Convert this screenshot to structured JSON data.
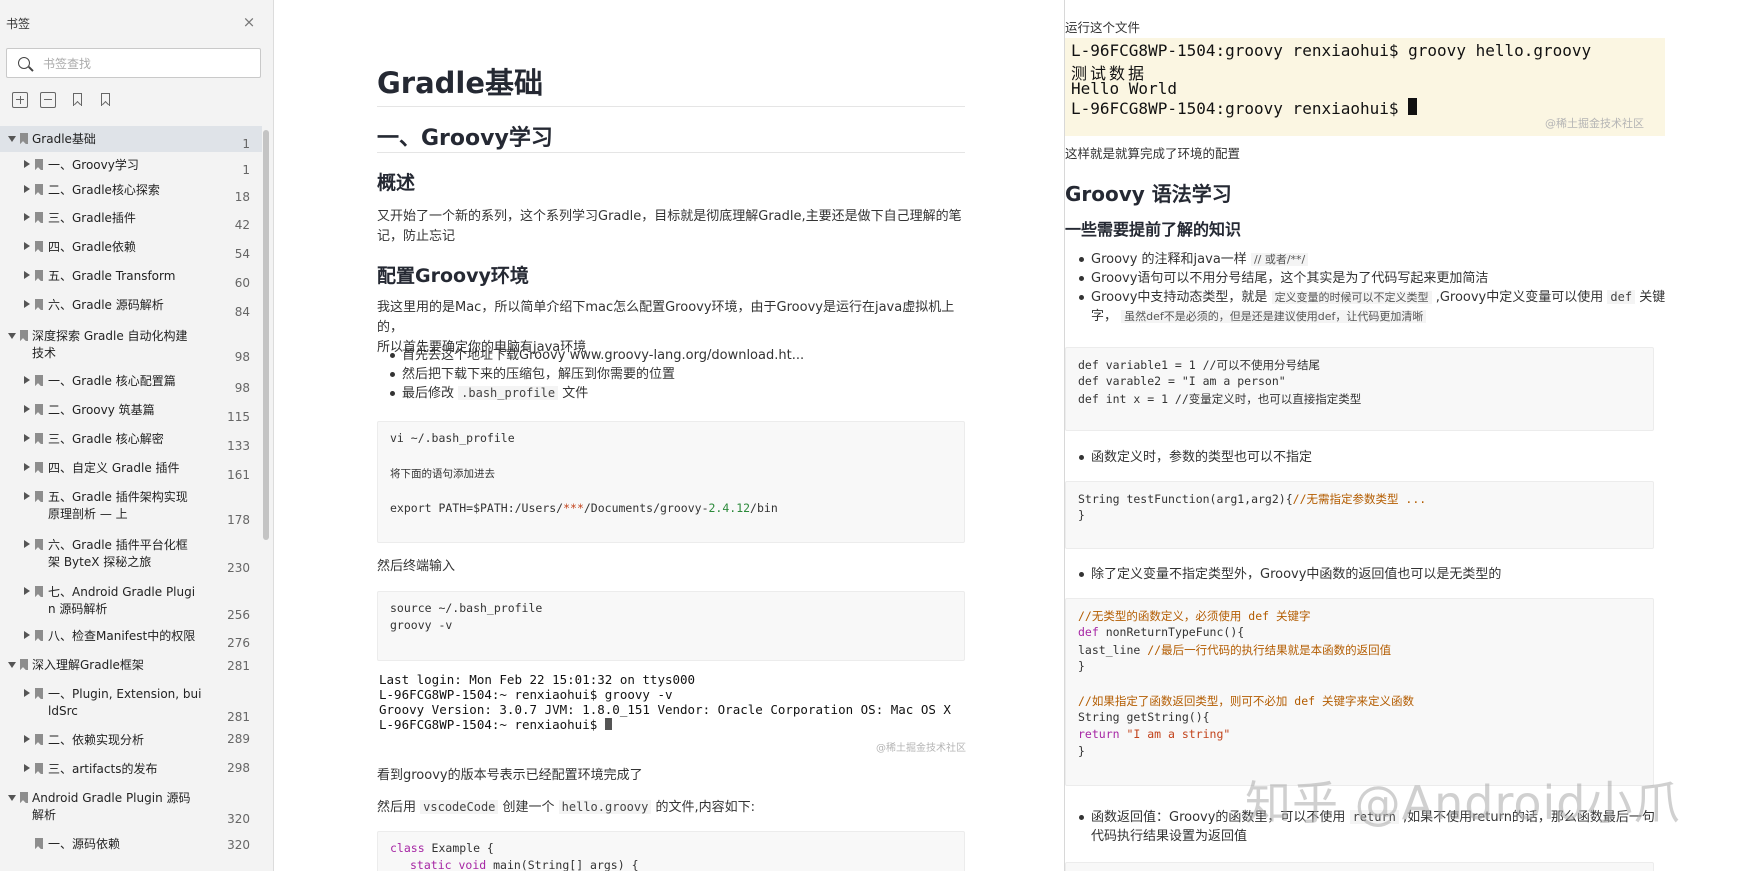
{
  "sidebar": {
    "title": "书签",
    "close_symbol": "×",
    "search_placeholder": "书签查找",
    "tools": [
      "expand-all-icon",
      "collapse-all-icon",
      "bookmark-icon",
      "bookmark-add-icon"
    ],
    "items": [
      {
        "label": "Gradle基础",
        "page": "1"
      },
      {
        "label": "一、Groovy学习",
        "page": "1"
      },
      {
        "label": "二、Gradle核心探索",
        "page": "18"
      },
      {
        "label": "三、Gradle插件",
        "page": "42"
      },
      {
        "label": "四、Gradle依赖",
        "page": "54"
      },
      {
        "label": "五、Gradle Transform",
        "page": "60"
      },
      {
        "label": "六、Gradle 源码解析",
        "page": "84"
      },
      {
        "label": "深度探索 Gradle 自动化构建",
        "label2": "技术",
        "page": "98"
      },
      {
        "label": "一、Gradle 核心配置篇",
        "page": "98"
      },
      {
        "label": "二、Groovy 筑基篇",
        "page": "115"
      },
      {
        "label": "三、Gradle 核心解密",
        "page": "133"
      },
      {
        "label": "四、自定义 Gradle 插件",
        "page": "161"
      },
      {
        "label": "五、Gradle 插件架构实现",
        "label2": "原理剖析 — 上",
        "page": "178"
      },
      {
        "label": "六、Gradle 插件平台化框",
        "label2": "架 ByteX 探秘之旅",
        "page": "230"
      },
      {
        "label": "七、Android Gradle Plugi",
        "label2": "n 源码解析",
        "page": "256"
      },
      {
        "label": "八、检查Manifest中的权限",
        "page": "276"
      },
      {
        "label": "深入理解Gradle框架",
        "page": "281"
      },
      {
        "label": "一、Plugin, Extension, bui",
        "label2": "ldSrc",
        "page": "281"
      },
      {
        "label": "二、依赖实现分析",
        "page": "289"
      },
      {
        "label": "三、artifacts的发布",
        "page": "298"
      },
      {
        "label": "Android Gradle Plugin 源码",
        "label2": "解析",
        "page": "320"
      },
      {
        "label": "一、源码依赖",
        "page": "320"
      }
    ]
  },
  "left_page": {
    "title": "Gradle基础",
    "h2": "一、Groovy学习",
    "h3_overview": "概述",
    "overview": "又开始了一个新的系列，这个系列学习Gradle，目标就是彻底理解Gradle,主要还是做下自己理解的笔",
    "overview2": "记，防止忘记",
    "h3_config": "配置Groovy环境",
    "config_p1": "我这里用的是Mac，所以简单介绍下mac怎么配置Groovy环境，由于Groovy是运行在java虚拟机上的，",
    "config_p2": "所以首先要确定你的电脑有java环境",
    "bullet1_pre": "首先去这个地址下载Groovy ",
    "bullet1_link": "www.groovy-lang.org/download.ht...",
    "bullet2": "然后把下载下来的压缩包，解压到你需要的位置",
    "bullet3_pre": "最后修改 ",
    "bullet3_code": ".bash_profile",
    "bullet3_post": " 文件",
    "code1_l1": "vi ~/.bash_profile",
    "code1_l2": "将下面的语句添加进去",
    "code1_l3a": "export PATH=$PATH:/Users/",
    "code1_l3b": "***",
    "code1_l3c": "/Documents/groovy-",
    "code1_l3d": "2.4.12",
    "code1_l3e": "/bin",
    "after_code1": "然后终端输入",
    "code2_l1": "source ~/.bash_profile",
    "code2_l2": "groovy -v",
    "term_l1": "Last login: Mon Feb 22 15:01:32 on ttys000",
    "term_l2": "L-96FCG8WP-1504:~ renxiaohui$ groovy -v",
    "term_l3": "Groovy Version: 3.0.7 JVM: 1.8.0_151 Vendor: Oracle Corporation OS: Mac OS X",
    "term_l4": "L-96FCG8WP-1504:~ renxiaohui$ ",
    "term_wm": "@稀土掘金技术社区",
    "after_term": "看到groovy的版本号表示已经配置环境完成了",
    "vscode_pre": "然后用 ",
    "vscode_code": "vscodeCode",
    "vscode_mid": " 创建一个 ",
    "vscode_code2": "hello.groovy",
    "vscode_post": " 的文件,内容如下:",
    "code3_l1a": "class",
    "code3_l1b": " Example {",
    "code3_l2a": "static",
    "code3_l2b": "void",
    "code3_l2c": " main(String[] args) {"
  },
  "right_page": {
    "run_label": "运行这个文件",
    "term_l1": "L-96FCG8WP-1504:groovy renxiaohui$ groovy hello.groovy",
    "term_l2": "测试数据",
    "term_l3": "Hello World",
    "term_l4": "L-96FCG8WP-1504:groovy renxiaohui$ ",
    "term_wm": "@稀土掘金技术社区",
    "done": "这样就是就算完成了环境的配置",
    "h2": "Groovy 语法学习",
    "h3": "一些需要提前了解的知识",
    "b1_pre": "Groovy 的注释和java一样 ",
    "b1_code": "// 或者/**/",
    "b2": "Groovy语句可以不用分号结尾，这个其实是为了代码写起来更加简洁",
    "b3_pre": "Groovy中支持动态类型，就是 ",
    "b3_code": "定义变量的时候可以不定义类型",
    "b3_mid": " ,Groovy中定义变量可以使用 ",
    "b3_code2": "def",
    "b3_post": " 关键",
    "b3_l2_pre": "字， ",
    "b3_l2_code": "虽然def不是必须的，但是还是建议使用def，让代码更加清晰",
    "code1_l1": "def variable1 = 1 //可以不使用分号结尾",
    "code1_l2": "def varable2 = \"I am a person\"",
    "code1_l3": "def int x = 1 //变量定义时，也可以直接指定类型",
    "b4": "函数定义时，参数的类型也可以不指定",
    "code2_l1a": "String testFunction(arg1,arg2){",
    "code2_l1b": "//无需指定参数类型 ...",
    "code2_l2": "}",
    "b5": "除了定义变量不指定类型外，Groovy中函数的返回值也可以是无类型的",
    "code3_l1": "//无类型的函数定义，必须使用 def 关键字",
    "code3_l2a": "def",
    "code3_l2b": " nonReturnTypeFunc(){",
    "code3_l3a": "last_line ",
    "code3_l3b": "//最后一行代码的执行结果就是本函数的返回值",
    "code3_l4": "}",
    "code3_l5": "//如果指定了函数返回类型，则可不必加 def 关键字来定义函数",
    "code3_l6": "String getString(){",
    "code3_l7a": "return",
    "code3_l7b": " \"I am a string\"",
    "code3_l8": "}",
    "b6_pre": "函数返回值：Groovy的函数里，可以不使用 ",
    "b6_code": "return",
    "b6_post": " ,如果不使用return的话，那么函数最后一句",
    "b6_l2": "代码执行结果设置为返回值"
  },
  "watermark": "知乎 @Android小爪",
  "colors": {
    "sidebar_bg": "#f3f3f3",
    "active_item": "#dfe3e8",
    "link": "#1e6bd6",
    "terminal_highlight": "#fbf6e2"
  }
}
